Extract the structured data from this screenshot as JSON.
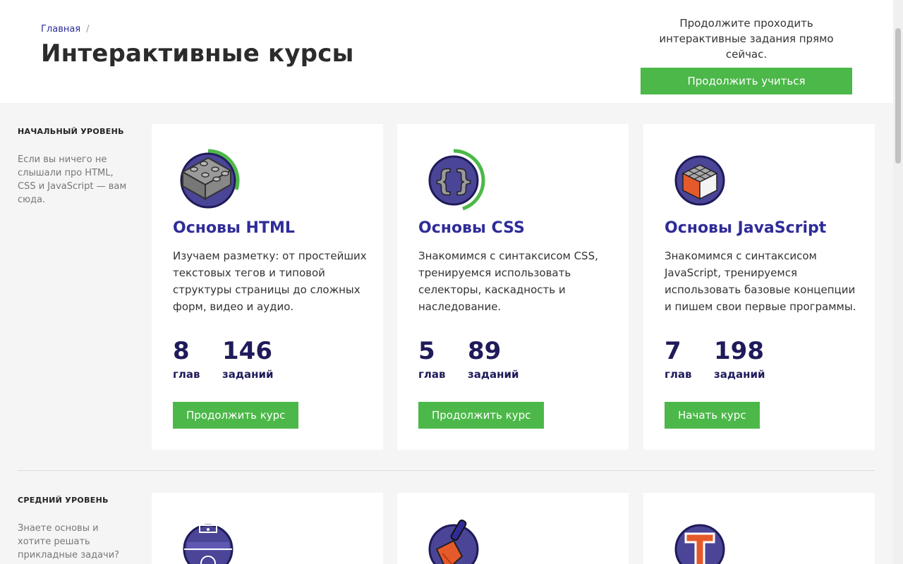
{
  "breadcrumb": {
    "home": "Главная",
    "separator": "/"
  },
  "page_title": "Интерактивные курсы",
  "promo": {
    "text": "Продолжите проходить интерактивные задания прямо сейчас.",
    "button": "Продолжить учиться"
  },
  "levels": [
    {
      "title": "НАЧАЛЬНЫЙ УРОВЕНЬ",
      "description": "Если вы ничего не слышали про HTML, CSS и JavaScript — вам сюда.",
      "cards": [
        {
          "icon": "lego-brick-icon",
          "progress": 0.3,
          "title": "Основы HTML",
          "description": "Изучаем разметку: от простейших текстовых тегов и типовой структуры страницы до сложных форм, видео и аудио.",
          "chapters": "8",
          "chapters_label": "глав",
          "tasks": "146",
          "tasks_label": "заданий",
          "button": "Продолжить курс"
        },
        {
          "icon": "curly-braces-icon",
          "progress": 0.45,
          "title": "Основы CSS",
          "description": "Знакомимся с синтаксисом CSS, тренируемся использовать селекторы, каскадность и наследование.",
          "chapters": "5",
          "chapters_label": "глав",
          "tasks": "89",
          "tasks_label": "заданий",
          "button": "Продолжить курс"
        },
        {
          "icon": "rubik-cube-icon",
          "progress": 0,
          "title": "Основы JavaScript",
          "description": "Знакомимся с синтаксисом JavaScript, тренируемся использовать базовые концепции и пишем свои первые программы.",
          "chapters": "7",
          "chapters_label": "глав",
          "tasks": "198",
          "tasks_label": "заданий",
          "button": "Начать курс"
        }
      ]
    },
    {
      "title": "СРЕДНИЙ УРОВЕНЬ",
      "description": "Знаете основы и хотите решать прикладные задачи? Это ваш",
      "cards": [
        {
          "icon": "football-field-icon"
        },
        {
          "icon": "paint-brush-icon"
        },
        {
          "icon": "typography-t-icon"
        }
      ]
    }
  ],
  "colors": {
    "accent_green": "#4cb849",
    "brand_purple": "#2f2c99",
    "icon_circle": "#4a4596",
    "stat_navy": "#1f1b5a"
  }
}
